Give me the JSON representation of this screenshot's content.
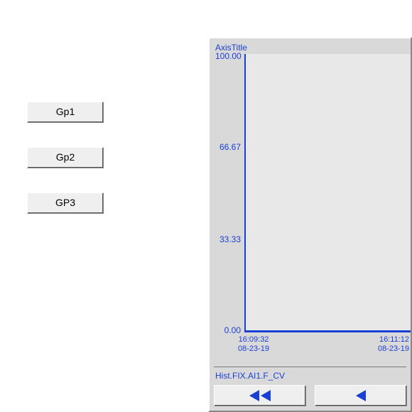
{
  "buttons": {
    "gp1": "Gp1",
    "gp2": "Gp2",
    "gp3": "GP3"
  },
  "chart_data": {
    "type": "line",
    "title": "AxisTitle",
    "xlabel": "",
    "ylabel": "AxisTitle",
    "ylim": [
      0,
      100
    ],
    "y_ticks": [
      "100.00",
      "66.67",
      "33.33",
      "0.00"
    ],
    "x_ticks": [
      {
        "time": "16:09:32",
        "date": "08-23-19"
      },
      {
        "time": "16:11:12",
        "date": "08-23-19"
      }
    ],
    "series": [
      {
        "name": "Hist.FIX.AI1.F_CV",
        "values": []
      }
    ]
  },
  "legend": {
    "item1": "Hist.FIX.AI1.F_CV"
  }
}
